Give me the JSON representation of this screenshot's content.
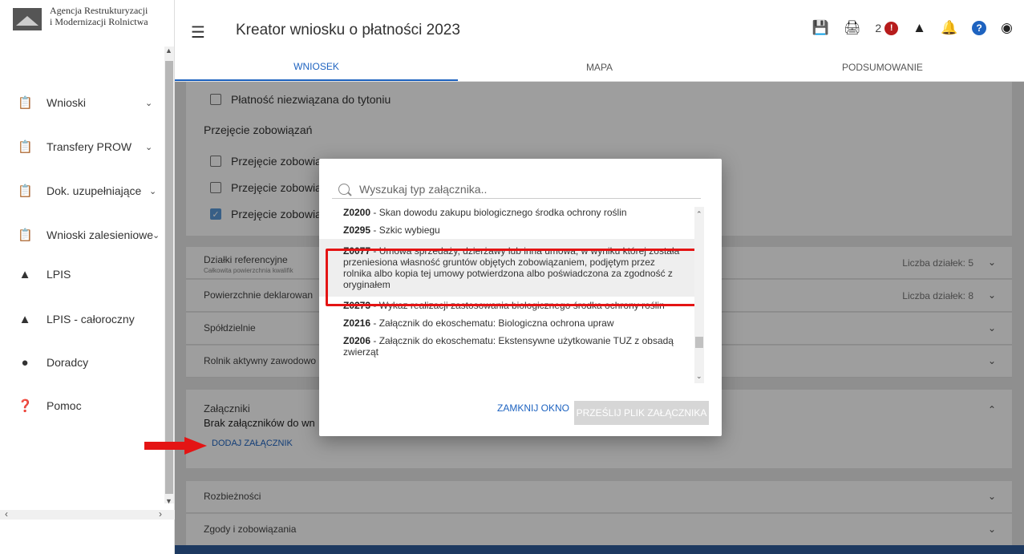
{
  "logo": {
    "line1": "Agencja Restrukturyzacji",
    "line2": "i Modernizacji Rolnictwa"
  },
  "sidebar": {
    "items": [
      {
        "label": "Wnioski",
        "icon": "clipboard-icon"
      },
      {
        "label": "Transfery PROW",
        "icon": "clipboard-icon"
      },
      {
        "label": "Dok. uzupełniające",
        "icon": "clipboard-icon"
      },
      {
        "label": "Wnioski zalesieniowe",
        "icon": "clipboard-icon"
      },
      {
        "label": "LPIS",
        "icon": "mountain-icon"
      },
      {
        "label": "LPIS - całoroczny",
        "icon": "mountain-icon"
      },
      {
        "label": "Doradcy",
        "icon": "person-icon"
      },
      {
        "label": "Pomoc",
        "icon": "help-circle-icon"
      }
    ]
  },
  "header": {
    "title": "Kreator wniosku o płatności 2023",
    "error_count": "2"
  },
  "tabs": [
    "WNIOSEK",
    "MAPA",
    "PODSUMOWANIE"
  ],
  "form": {
    "tobacco_label": "Płatność niezwiązana do tytoniu",
    "takeover_title": "Przejęcie zobowiązań",
    "takeover_1": "Przejęcie zobowiąz",
    "takeover_2": "Przejęcie zobowiąz",
    "takeover_3": "Przejęcie zobowiąz"
  },
  "sections": {
    "dzialki": {
      "label": "Działki referencyjne",
      "sub": "Całkowita powierzchnia kwalifik",
      "count": "Liczba działek: 5"
    },
    "powierzchnie": {
      "label": "Powierzchnie deklarowan",
      "count": "Liczba działek: 8"
    },
    "spoldzielnie": {
      "label": "Spółdzielnie"
    },
    "rolnik": {
      "label": "Rolnik aktywny zawodowo"
    },
    "zalaczniki": {
      "label": "Załączniki",
      "empty": "Brak załączników do wn",
      "add": "DODAJ ZAŁĄCZNIK"
    },
    "rozbieznosci": {
      "label": "Rozbieżności"
    },
    "zgody": {
      "label": "Zgody i zobowiązania"
    }
  },
  "dialog": {
    "search_placeholder": "Wyszukaj typ załącznika..",
    "options": [
      {
        "code": "Z0200",
        "text": " - Skan dowodu zakupu biologicznego środka ochrony roślin"
      },
      {
        "code": "Z0295",
        "text": " - Szkic wybiegu"
      },
      {
        "code": "Z0077",
        "text": " - Umowa sprzedaży, dzierżawy lub inna umowa, w wyniku której została przeniesiona własność gruntów objętych zobowiązaniem, podjętym przez rolnika albo kopia tej umowy potwierdzona albo poświadczona za zgodność z oryginałem"
      },
      {
        "code": "Z0273",
        "text": " - Wykaz realizacji zastosowania biologicznego środka ochrony roślin"
      },
      {
        "code": "Z0216",
        "text": " - Załącznik do ekoschematu: Biologiczna ochrona upraw"
      },
      {
        "code": "Z0206",
        "text": " - Załącznik do ekoschematu: Ekstensywne użytkowanie TUZ z obsadą zwierząt"
      }
    ],
    "close_label": "ZAMKNIJ OKNO",
    "send_label": "PRZEŚLIJ PLIK ZAŁĄCZNIKA"
  },
  "colors": {
    "accent": "#1e63c0",
    "annotation_red": "#e41414",
    "error_badge": "#b71c1c",
    "footer_bar": "#2f5d9c"
  }
}
